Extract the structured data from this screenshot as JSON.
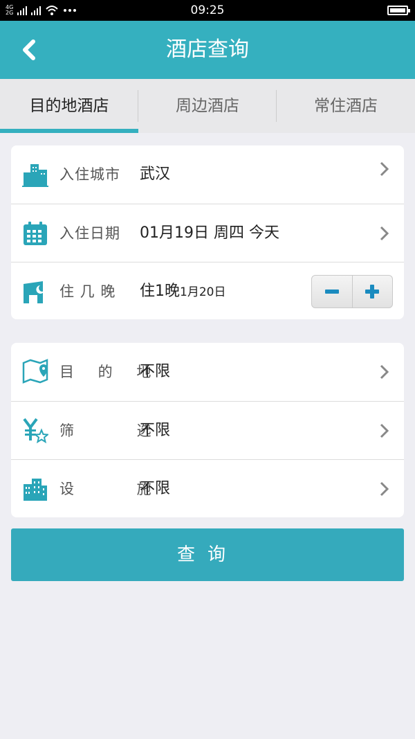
{
  "status_bar": {
    "network_1": "4G",
    "network_2": "2G",
    "time": "09:25"
  },
  "header": {
    "title": "酒店查询",
    "back_icon": "chevron-left-icon"
  },
  "tabs": [
    {
      "label": "目的地酒店",
      "active": true
    },
    {
      "label": "周边酒店",
      "active": false
    },
    {
      "label": "常住酒店",
      "active": false
    }
  ],
  "booking": {
    "city": {
      "label": "入住城市",
      "value": "武汉",
      "icon": "city-buildings-icon"
    },
    "date": {
      "label": "入住日期",
      "value": "01月19日 周四 今天",
      "icon": "calendar-icon"
    },
    "nights": {
      "label": "住 几 晚",
      "value": "住1晚",
      "checkout": "1月20日",
      "icon": "night-stay-icon"
    }
  },
  "filters": {
    "destination": {
      "label": "目 的 地",
      "value": "不限",
      "icon": "map-pin-icon"
    },
    "screening": {
      "label": "筛 选",
      "value": "不限",
      "icon": "yen-star-icon"
    },
    "facilities": {
      "label": "设 施",
      "value": "不限",
      "icon": "building-icon"
    }
  },
  "search_button": "查询",
  "colors": {
    "accent": "#35b0bf",
    "background": "#eeeef3"
  }
}
